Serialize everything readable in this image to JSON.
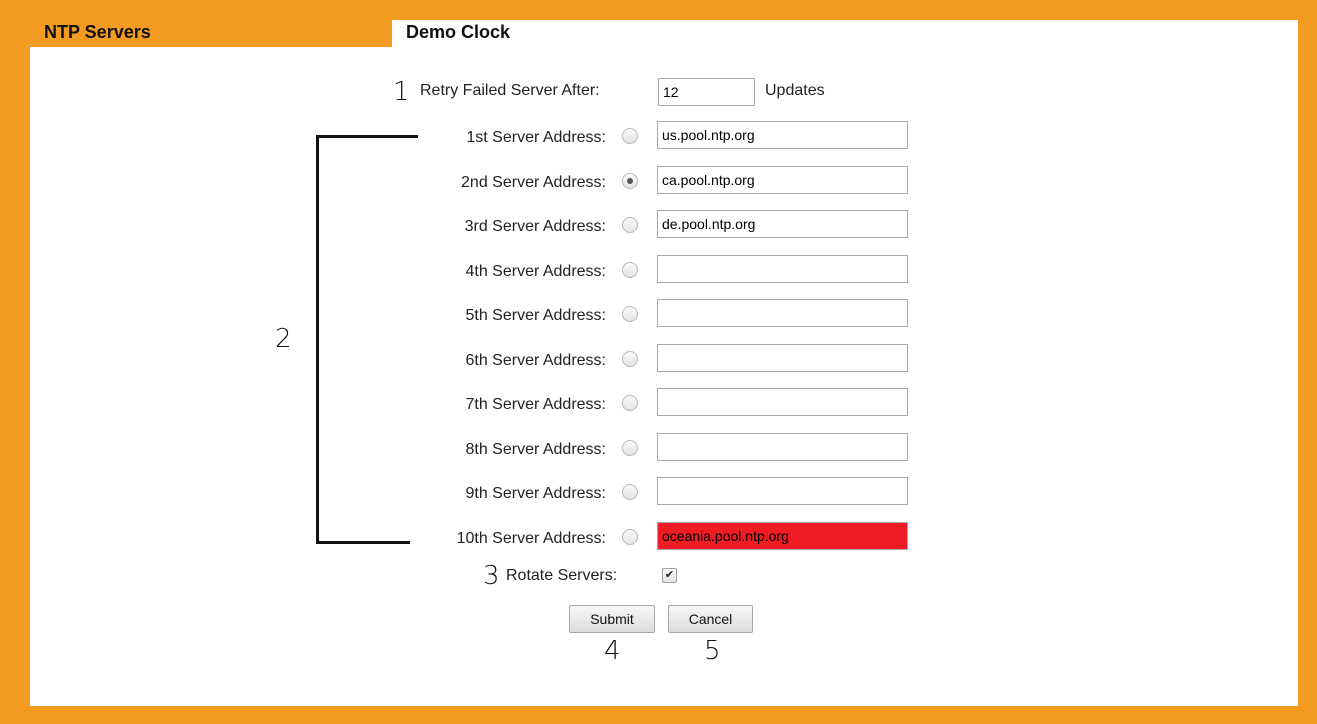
{
  "tabs": {
    "ntp_servers": "NTP Servers",
    "demo_clock": "Demo Clock"
  },
  "retry": {
    "label": "Retry Failed Server After:",
    "value": "12",
    "unit": "Updates"
  },
  "servers": [
    {
      "label": "1st Server Address:",
      "value": "us.pool.ntp.org",
      "selected": false,
      "error": false
    },
    {
      "label": "2nd Server Address:",
      "value": "ca.pool.ntp.org",
      "selected": true,
      "error": false
    },
    {
      "label": "3rd Server Address:",
      "value": "de.pool.ntp.org",
      "selected": false,
      "error": false
    },
    {
      "label": "4th Server Address:",
      "value": "",
      "selected": false,
      "error": false
    },
    {
      "label": "5th Server Address:",
      "value": "",
      "selected": false,
      "error": false
    },
    {
      "label": "6th Server Address:",
      "value": "",
      "selected": false,
      "error": false
    },
    {
      "label": "7th Server Address:",
      "value": "",
      "selected": false,
      "error": false
    },
    {
      "label": "8th Server Address:",
      "value": "",
      "selected": false,
      "error": false
    },
    {
      "label": "9th Server Address:",
      "value": "",
      "selected": false,
      "error": false
    },
    {
      "label": "10th Server Address:",
      "value": "oceania.pool.ntp.org",
      "selected": false,
      "error": true
    }
  ],
  "rotate": {
    "label": "Rotate Servers:",
    "checked": true
  },
  "buttons": {
    "submit": "Submit",
    "cancel": "Cancel"
  },
  "callouts": {
    "c1": "1",
    "c2": "2",
    "c3": "3",
    "c4": "4",
    "c5": "5"
  },
  "colors": {
    "frame": "#f39b21",
    "error_field": "#ee1c24"
  }
}
